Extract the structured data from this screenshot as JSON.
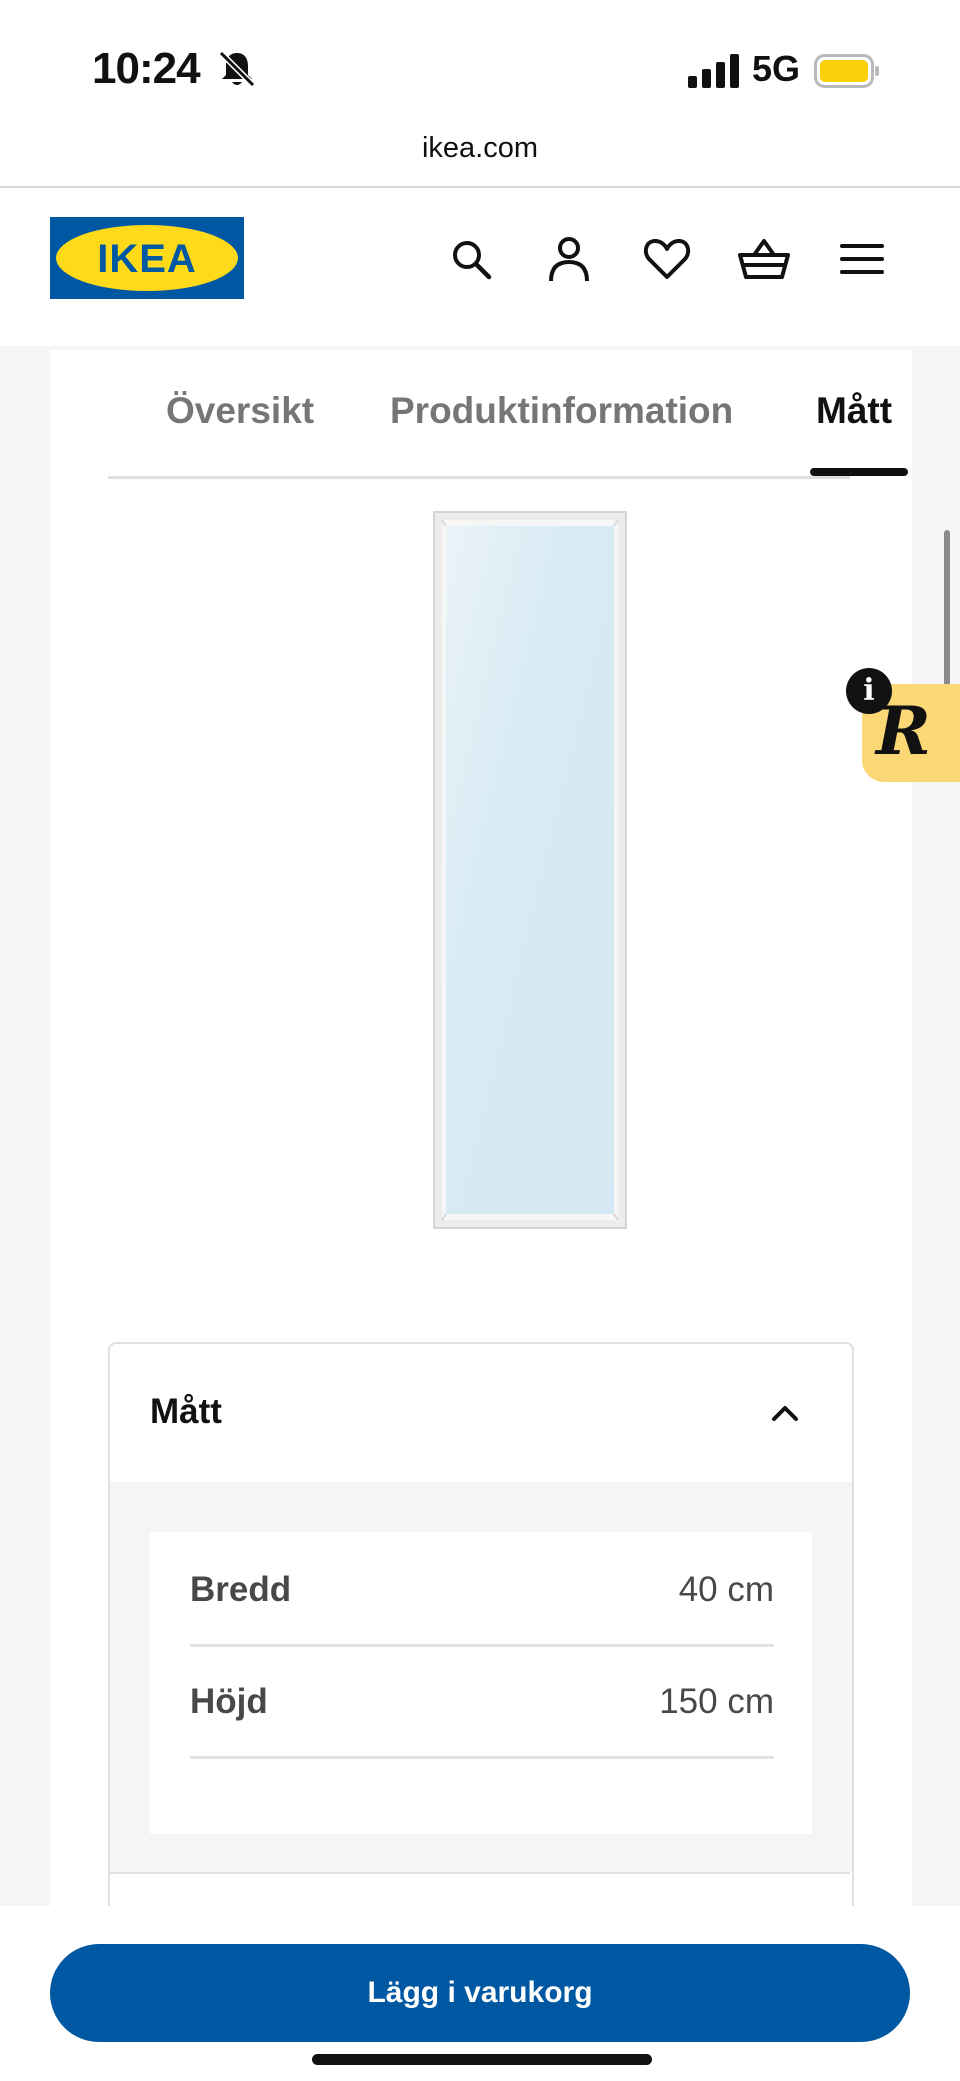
{
  "status_bar": {
    "time": "10:24",
    "network": "5G"
  },
  "browser": {
    "url": "ikea.com"
  },
  "header": {
    "logo_text": "IKEA",
    "icons": [
      "search-icon",
      "user-icon",
      "heart-icon",
      "cart-icon",
      "menu-icon"
    ]
  },
  "tabs": [
    {
      "label": "Översikt",
      "active": false
    },
    {
      "label": "Produktinformation",
      "active": false
    },
    {
      "label": "Mått",
      "active": true
    }
  ],
  "dimensions": {
    "title": "Mått",
    "expanded": true,
    "rows": [
      {
        "label": "Bredd",
        "value": "40 cm"
      },
      {
        "label": "Höjd",
        "value": "150 cm"
      }
    ]
  },
  "widget": {
    "letter": "R",
    "info": "i"
  },
  "cta": {
    "label": "Lägg i varukorg"
  },
  "colors": {
    "ikea_blue": "#0058a3",
    "ikea_yellow": "#ffda1a",
    "widget_yellow": "#fcd775",
    "battery": "#f9d10a"
  }
}
